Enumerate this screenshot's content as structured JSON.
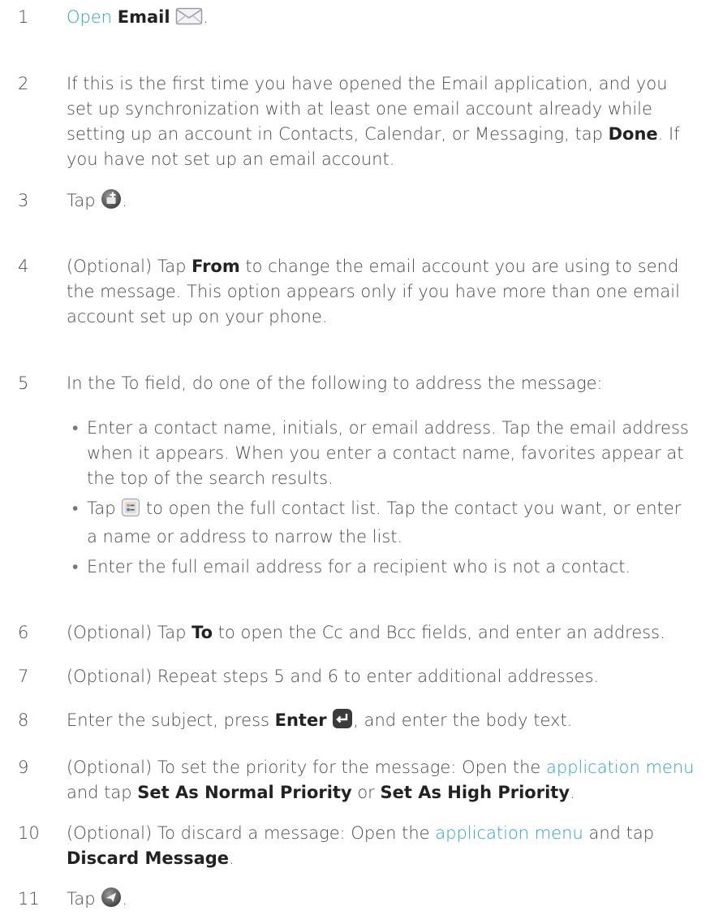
{
  "steps": [
    {
      "num": "1",
      "open": "Open",
      "app": "Email",
      "end": "."
    },
    {
      "num": "2",
      "text": "If this is the first time you have opened the Email application, and you set up synchronization with at least one email account already while setting up an account in Contacts, Calendar, or Messaging, tap ",
      "bold": "Done",
      "rest": ". If you have not set up an email account."
    },
    {
      "num": "3",
      "pre": "Tap",
      "end": "."
    },
    {
      "num": "4",
      "pre": "(Optional) Tap ",
      "bold": "From",
      "rest": " to change the email account you are using to send the message. This option appears only if you have more than one email account set up on your phone."
    },
    {
      "num": "5",
      "text": "In the To field, do one of the following to address the message:"
    },
    {
      "num": "6",
      "pre": "(Optional) Tap ",
      "bold": "To",
      "rest": " to open the Cc and Bcc fields, and enter an address."
    },
    {
      "num": "7",
      "text": "(Optional) Repeat steps 5 and 6 to enter additional addresses."
    },
    {
      "num": "8",
      "pre": "Enter the subject, press ",
      "bold": "Enter",
      "rest": ", and enter the body text."
    },
    {
      "num": "9",
      "pre": "(Optional) To set the priority for the message: Open the ",
      "link": "application menu",
      "mid": " and tap ",
      "bold1": "Set As Normal Priority",
      "or": " or ",
      "bold2": "Set As High Priority",
      "end": "."
    },
    {
      "num": "10",
      "pre": "(Optional) To discard a message: Open the ",
      "link": "application menu",
      "mid": " and tap ",
      "bold": "Discard Message",
      "end": "."
    },
    {
      "num": "11",
      "pre": "Tap",
      "end": "."
    }
  ],
  "bullets": [
    {
      "text": "Enter a contact name, initials, or email address. Tap the email address when it appears. When you enter a contact name, favorites appear at the top of the search results."
    },
    {
      "pre": "Tap ",
      "rest": " to open the full contact list. Tap the contact you want, or enter a name or address to narrow the list."
    },
    {
      "text": "Enter the full email address for a recipient who is not a contact."
    }
  ],
  "bullet_char": "•",
  "icons": {
    "step1": "envelope-icon",
    "step3": "new-message-plus-icon",
    "bullet2": "contacts-list-icon",
    "step8": "enter-key-icon",
    "step11": "send-icon"
  }
}
